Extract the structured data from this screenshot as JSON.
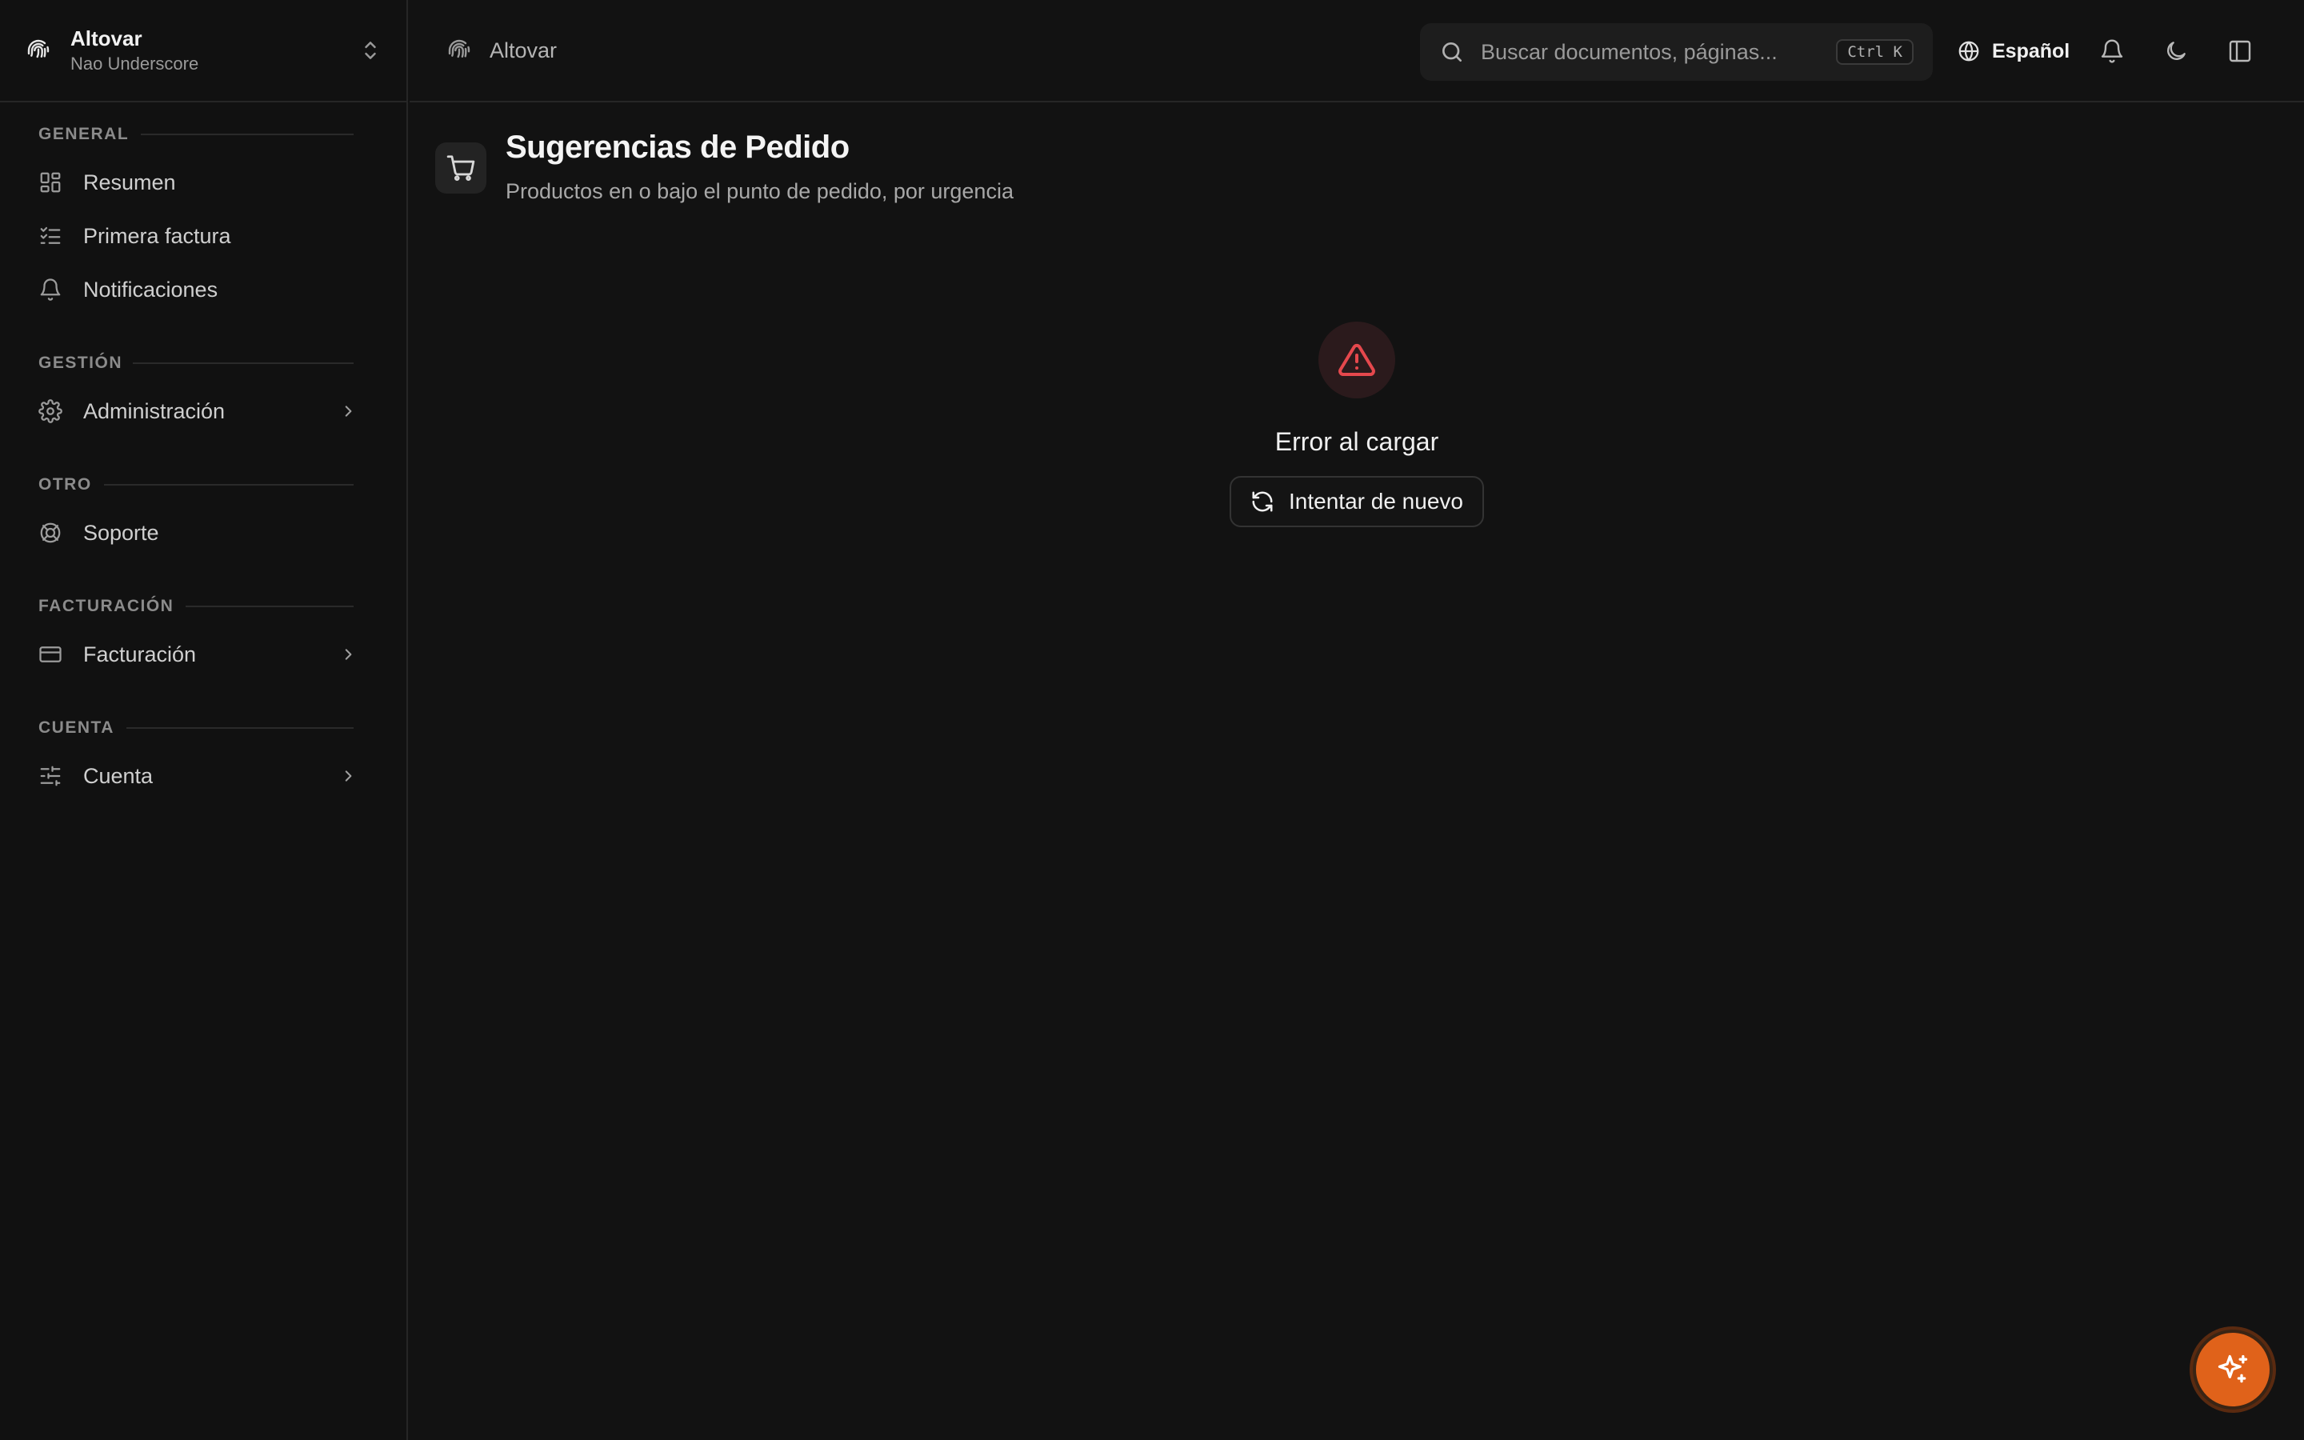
{
  "org": {
    "name": "Altovar",
    "subtitle": "Nao Underscore"
  },
  "sidebar": {
    "sections": [
      {
        "title": "GENERAL",
        "items": [
          {
            "label": "Resumen",
            "icon": "dashboard-icon"
          },
          {
            "label": "Primera factura",
            "icon": "checklist-icon"
          },
          {
            "label": "Notificaciones",
            "icon": "bell-icon"
          }
        ]
      },
      {
        "title": "GESTIÓN",
        "items": [
          {
            "label": "Administración",
            "icon": "gear-icon",
            "has_submenu": true
          }
        ]
      },
      {
        "title": "OTRO",
        "items": [
          {
            "label": "Soporte",
            "icon": "lifebuoy-icon"
          }
        ]
      },
      {
        "title": "FACTURACIÓN",
        "items": [
          {
            "label": "Facturación",
            "icon": "credit-card-icon",
            "has_submenu": true
          }
        ]
      },
      {
        "title": "CUENTA",
        "items": [
          {
            "label": "Cuenta",
            "icon": "sliders-icon",
            "has_submenu": true
          }
        ]
      }
    ]
  },
  "topbar": {
    "breadcrumb": "Altovar",
    "search_placeholder": "Buscar documentos, páginas...",
    "search_shortcut": "Ctrl K",
    "language": "Español"
  },
  "page": {
    "title": "Sugerencias de Pedido",
    "subtitle": "Productos en o bajo el punto de pedido, por urgencia"
  },
  "error": {
    "message": "Error al cargar",
    "retry_label": "Intentar de nuevo"
  },
  "colors": {
    "accent": "#e0621a",
    "error": "#e5484d",
    "background": "#121212"
  }
}
